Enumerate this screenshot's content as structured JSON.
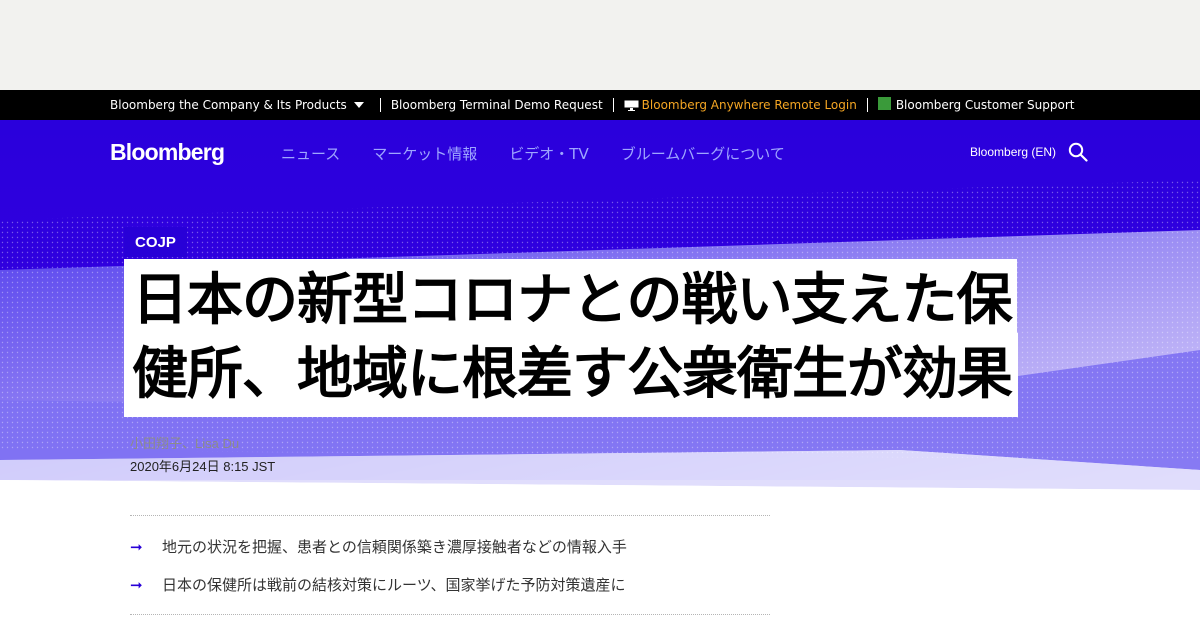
{
  "top_bar": {
    "company": "Bloomberg the Company & Its Products",
    "terminal_demo": "Bloomberg Terminal Demo Request",
    "anywhere_login": "Bloomberg Anywhere Remote Login",
    "customer_support": "Bloomberg Customer Support"
  },
  "header": {
    "logo": "Bloomberg",
    "nav": [
      "ニュース",
      "マーケット情報",
      "ビデオ・TV",
      "ブルームバーグについて"
    ],
    "language": "Bloomberg (EN)"
  },
  "article": {
    "kicker": "COJP",
    "headline_lines": [
      "日本の新型コロナとの戦い支えた保",
      "健所、地域に根差す公衆衛生が効果"
    ],
    "byline": "小田翔子、Lisa Du",
    "date": "2020年6月24日 8:15 JST",
    "bullets": [
      "地元の状況を把握、患者との信頼関係築き濃厚接触者などの情報入手",
      "日本の保健所は戦前の結核対策にルーツ、国家挙げた予防対策遺産に"
    ]
  },
  "colors": {
    "brand_blue": "#2800d7",
    "anywhere_orange": "#f5a623",
    "nav_link": "#9fa6ff"
  },
  "icons": [
    "caret-down-icon",
    "monitor-icon",
    "support-icon",
    "search-icon",
    "arrow-right-icon"
  ]
}
